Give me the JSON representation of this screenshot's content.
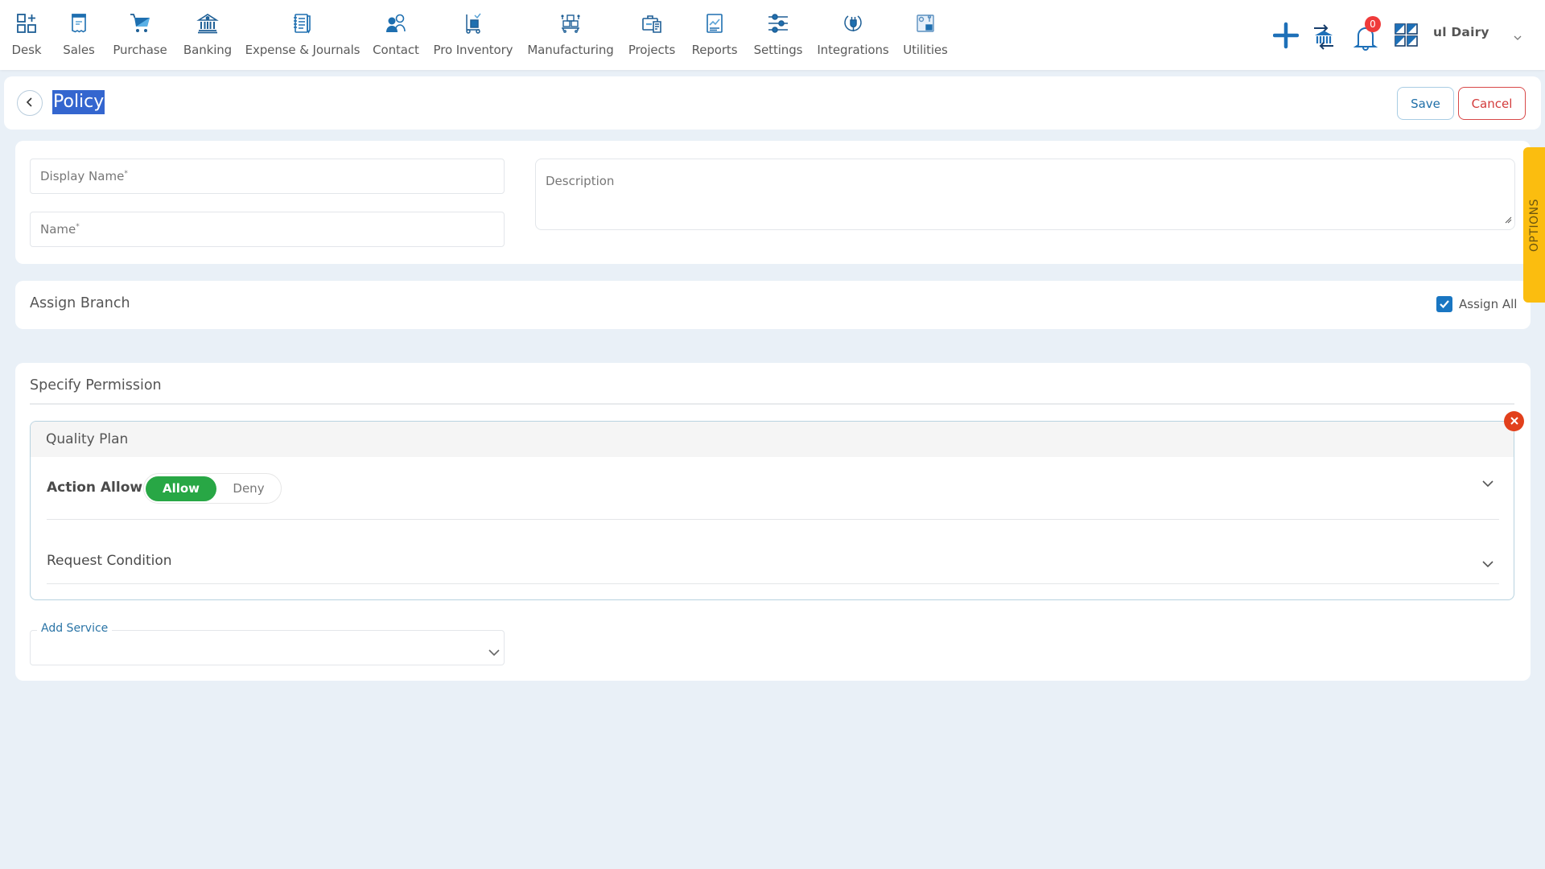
{
  "nav": {
    "items": [
      {
        "label": "Desk",
        "icon": "desk-icon"
      },
      {
        "label": "Sales",
        "icon": "receipt-icon"
      },
      {
        "label": "Purchase",
        "icon": "cart-icon"
      },
      {
        "label": "Banking",
        "icon": "bank-icon"
      },
      {
        "label": "Expense & Journals",
        "icon": "notebook-icon"
      },
      {
        "label": "Contact",
        "icon": "contacts-icon"
      },
      {
        "label": "Pro Inventory",
        "icon": "forklift-icon"
      },
      {
        "label": "Manufacturing",
        "icon": "boxes-icon"
      },
      {
        "label": "Projects",
        "icon": "briefcase-icon"
      },
      {
        "label": "Reports",
        "icon": "report-chart-icon"
      },
      {
        "label": "Settings",
        "icon": "sliders-icon"
      },
      {
        "label": "Integrations",
        "icon": "plug-icon"
      },
      {
        "label": "Utilities",
        "icon": "utilities-icon"
      }
    ],
    "notification_count": "0",
    "company_name": "ul Dairy"
  },
  "header": {
    "title": "Policy",
    "save_label": "Save",
    "cancel_label": "Cancel"
  },
  "form": {
    "display_name": {
      "label": "Display Name",
      "required_mark": "*",
      "value": ""
    },
    "name": {
      "label": "Name",
      "required_mark": "*",
      "value": ""
    },
    "description": {
      "placeholder": "Description",
      "value": ""
    }
  },
  "assign_branch": {
    "title": "Assign Branch",
    "assign_all_label": "Assign All",
    "assign_all_checked": true
  },
  "permission": {
    "title": "Specify Permission",
    "services": [
      {
        "name": "Quality Plan",
        "action_label": "Action Allow",
        "action_options": [
          "Allow",
          "Deny"
        ],
        "action_selected": "Allow",
        "request_condition_label": "Request Condition"
      }
    ],
    "add_service_label": "Add Service",
    "add_service_value": ""
  },
  "options_tab_label": "OPTIONS",
  "colors": {
    "brand_blue": "#1f6fa8",
    "allow_green": "#28a745",
    "cancel_red": "#d33b3b",
    "close_red": "#e2401c",
    "options_yellow": "#fbbd0f",
    "badge_red": "#ef3b3b"
  }
}
